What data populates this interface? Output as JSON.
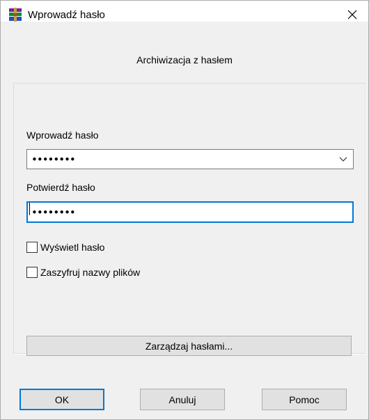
{
  "window": {
    "title": "Wprowadź hasło",
    "subtitle": "Archiwizacja z hasłem"
  },
  "fields": {
    "password_label": "Wprowadź hasło",
    "password_value": "••••••••",
    "confirm_label": "Potwierdź hasło",
    "confirm_value": "••••••••"
  },
  "options": {
    "show_password": "Wyświetl hasło",
    "encrypt_names": "Zaszyfruj nazwy plików"
  },
  "buttons": {
    "manage": "Zarządzaj hasłami...",
    "ok": "OK",
    "cancel": "Anuluj",
    "help": "Pomoc"
  },
  "colors": {
    "accent": "#0078d7",
    "background": "#f0f0f0"
  },
  "icons": {
    "app": "winrar-icon",
    "close": "close-icon",
    "dropdown": "chevron-down-icon"
  }
}
